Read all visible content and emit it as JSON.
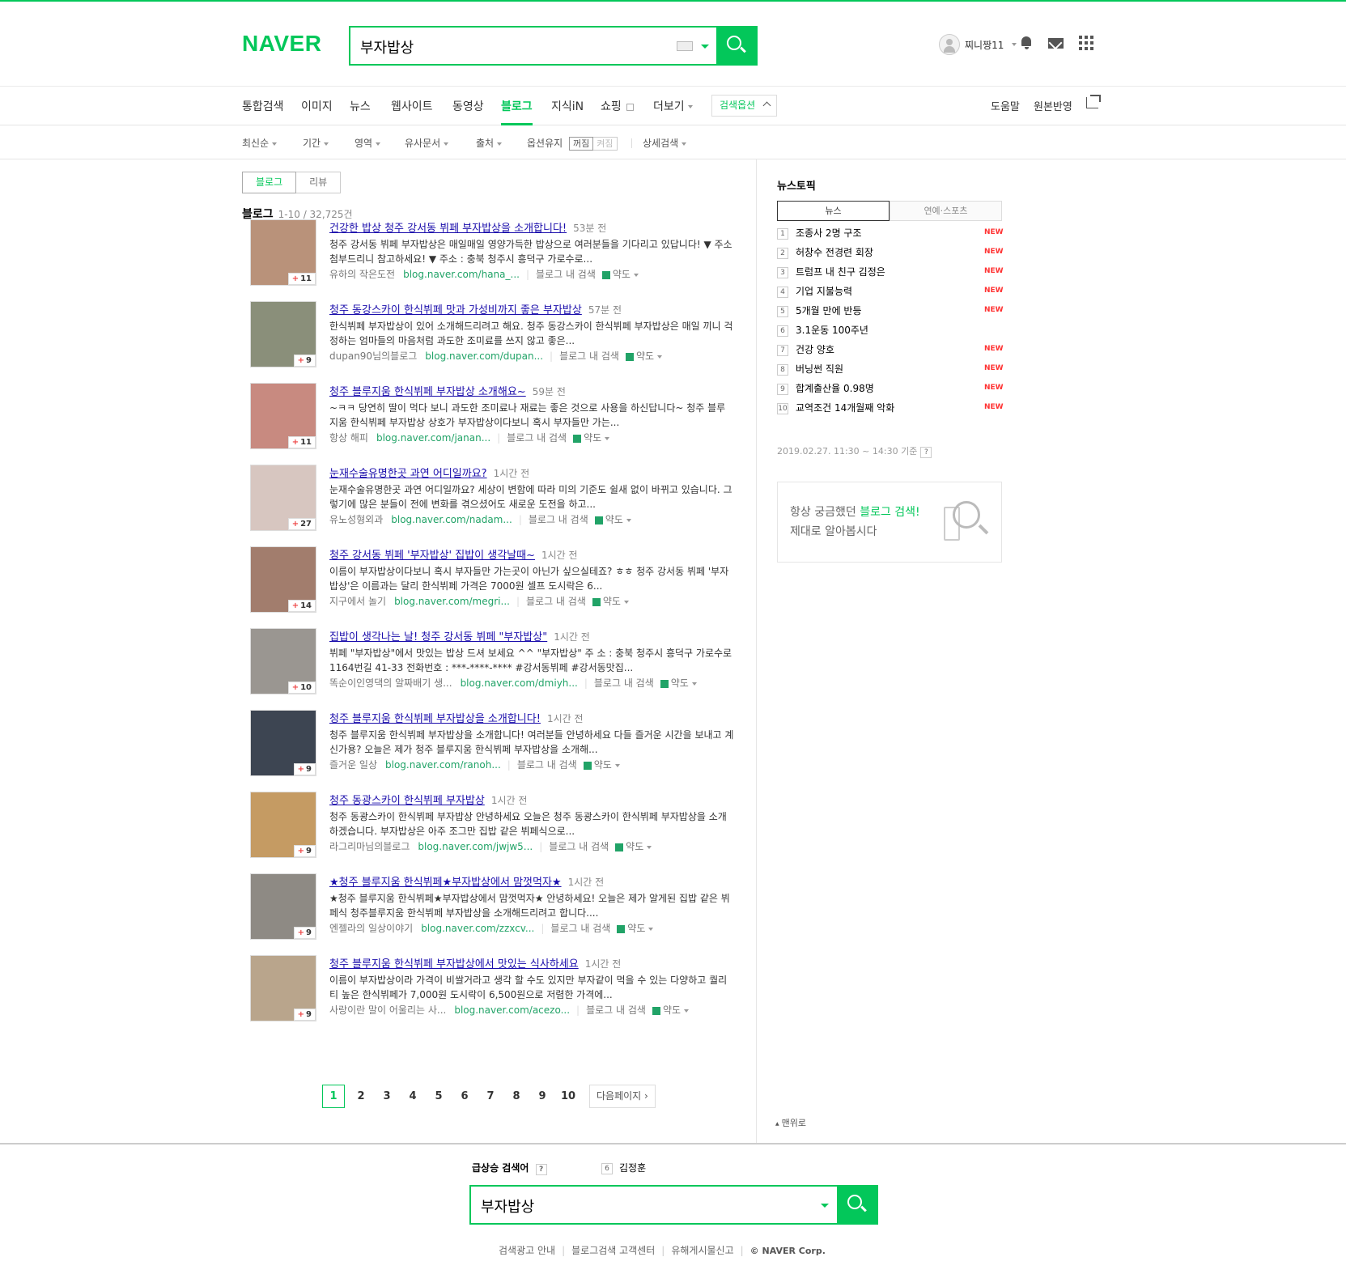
{
  "header": {
    "logo": "NAVER",
    "query": "부자밥상",
    "user_name": "찌니짱11"
  },
  "tabs": [
    "통합검색",
    "이미지",
    "뉴스",
    "웹사이트",
    "동영상",
    "블로그",
    "지식iN",
    "쇼핑",
    "더보기",
    "검색옵션"
  ],
  "right_tabs": [
    "도움말",
    "원본반영"
  ],
  "filters": {
    "sort": "최신순",
    "period": "기간",
    "area": "영역",
    "similar": "유사문서",
    "source": "출처",
    "keep_option": "옵션유지",
    "on": "꺼짐",
    "off": "켜짐",
    "detail": "상세검색"
  },
  "subtabs": [
    "블로그",
    "리뷰"
  ],
  "result_count": {
    "label": "블로그",
    "range": "1-10 / 32,725건"
  },
  "results": [
    {
      "title": "건강한 밥상 청주 강서동 뷔페 부자밥상을 소개합니다!",
      "time": "53분 전",
      "desc": "청주 강서동 뷔페 부자밥상은 매일매일 영양가득한 밥상으로 여러분들을 기다리고 있답니다! ▼ 주소 첨부드리니 참고하세요! ▼ 주소 : 충북 청주시 흥덕구 가로수로...",
      "author": "유하의 작은도전",
      "url": "blog.naver.com/hana_...",
      "inblog": "블로그 내 검색",
      "map": "약도",
      "count": "11"
    },
    {
      "title": "청주 동강스카이 한식뷔페 맛과 가성비까지 좋은 부자밥상",
      "time": "57분 전",
      "desc": "한식뷔페 부자밥상이 있어 소개해드리려고 해요. 청주 동강스카이 한식뷔페 부자밥상은 매일 끼니 걱정하는 엄마들의 마음처럼 과도한 조미료를 쓰지 않고 좋은...",
      "author": "dupan90님의블로그",
      "url": "blog.naver.com/dupan...",
      "inblog": "블로그 내 검색",
      "map": "약도",
      "count": "9"
    },
    {
      "title": "청주 블루지움 한식뷔페 부자밥상 소개해요~",
      "time": "59분 전",
      "desc": "~ㅋㅋ 당연히 딸이 먹다 보니 과도한 조미료나 재료는 좋은 것으로 사용을 하신답니다~ 청주 블루지움 한식뷔페 부자밥상 상호가 부자밥상이다보니 혹시 부자들만 가는...",
      "author": "항상 해피",
      "url": "blog.naver.com/janan...",
      "inblog": "블로그 내 검색",
      "map": "약도",
      "count": "11"
    },
    {
      "title": "눈재수술유명한곳 과연 어디일까요?",
      "time": "1시간 전",
      "desc": "눈재수술유명한곳 과연 어디일까요? 세상이 변함에 따라 미의 기준도 쉴새 없이 바뀌고 있습니다. 그렇기에 많은 분들이 전에 변화를 겪으셨어도 새로운 도전을 하고...",
      "author": "유노성형외과",
      "url": "blog.naver.com/nadam...",
      "inblog": "블로그 내 검색",
      "map": "약도",
      "count": "27"
    },
    {
      "title": "청주 강서동 뷔페 '부자밥상' 집밥이 생각날때~",
      "time": "1시간 전",
      "desc": "이름이 부자밥상이다보니 혹시 부자들만 가는곳이 아닌가 싶으실테죠? ㅎㅎ 청주 강서동 뷔페 '부자밥상'은 이름과는 달리 한식뷔페 가격은 7000원 셀프 도시락은 6...",
      "author": "지구에서 놀기",
      "url": "blog.naver.com/megri...",
      "inblog": "블로그 내 검색",
      "map": "약도",
      "count": "14"
    },
    {
      "title": "집밥이 생각나는 날! 청주 강서동 뷔페 \"부자밥상\"",
      "time": "1시간 전",
      "desc": "뷔페 \"부자밥상\"에서 맛있는 밥상 드셔 보세요 ^^ \"부자밥상\" 주 소 : 충북 청주시 흥덕구 가로수로1164번길 41-33 전화번호 : ***-****-**** #강서동뷔페 #강서동맛집...",
      "author": "똑순이인영댁의 알짜배기 생...",
      "url": "blog.naver.com/dmiyh...",
      "inblog": "블로그 내 검색",
      "map": "약도",
      "count": "10"
    },
    {
      "title": "청주 블루지움 한식뷔페 부자밥상을 소개합니다!",
      "time": "1시간 전",
      "desc": "청주 블루지움 한식뷔페 부자밥상을 소개합니다! 여러분들 안녕하세요 다들 즐거운 시간을 보내고 계신가용? 오늘은 제가 청주 블루지움 한식뷔페 부자밥상을 소개해...",
      "author": "즐거운 일상",
      "url": "blog.naver.com/ranoh...",
      "inblog": "블로그 내 검색",
      "map": "약도",
      "count": "9"
    },
    {
      "title": "청주 동광스카이 한식뷔페 부자밥상",
      "time": "1시간 전",
      "desc": "청주 동광스카이 한식뷔페 부자밥상 안녕하세요 오늘은 청주 동광스카이 한식뷔페 부자밥상을 소개하겠습니다. 부자밥상은 아주 조그만 집밥 같은 뷔페식으로...",
      "author": "라그리마님의블로그",
      "url": "blog.naver.com/jwjw5...",
      "inblog": "블로그 내 검색",
      "map": "약도",
      "count": "9"
    },
    {
      "title": "★청주 블루지움 한식뷔페★부자밥상에서 맘껏먹자★",
      "time": "1시간 전",
      "desc": "★청주 블루지움 한식뷔페★부자밥상에서 맘껏먹자★ 안녕하세요! 오늘은 제가 알게된 집밥 같은 뷔페식 청주블루지움 한식뷔페 부자밥상을 소개해드리려고 합니다....",
      "author": "엔젤라의 일상이야기",
      "url": "blog.naver.com/zzxcv...",
      "inblog": "블로그 내 검색",
      "map": "약도",
      "count": "9"
    },
    {
      "title": "청주 블루지움 한식뷔페 부자밥상에서 맛있는 식사하세요",
      "time": "1시간 전",
      "desc": "이름이 부자밥상이라 가격이 비쌀거라고 생각 할 수도 있지만 부자같이 먹을 수 있는 다양하고 퀄리티 높은 한식뷔페가 7,000원 도시락이 6,500원으로 저렴한 가격에...",
      "author": "사랑이란 말이 어울리는 사...",
      "url": "blog.naver.com/acezo...",
      "inblog": "블로그 내 검색",
      "map": "약도",
      "count": "9"
    }
  ],
  "pager": {
    "pages": [
      "1",
      "2",
      "3",
      "4",
      "5",
      "6",
      "7",
      "8",
      "9",
      "10"
    ],
    "next": "다음페이지"
  },
  "sidebar": {
    "title": "뉴스토픽",
    "tabs": [
      "뉴스",
      "연예·스포츠"
    ],
    "topics": [
      {
        "rank": "1",
        "text": "조종사 2명 구조",
        "new": "NEW"
      },
      {
        "rank": "2",
        "text": "허창수 전경련 회장",
        "new": "NEW"
      },
      {
        "rank": "3",
        "text": "트럼프 내 친구 김정은",
        "new": "NEW"
      },
      {
        "rank": "4",
        "text": "기업 지불능력",
        "new": "NEW"
      },
      {
        "rank": "5",
        "text": "5개월 만에 반등",
        "new": "NEW"
      },
      {
        "rank": "6",
        "text": "3.1운동 100주년",
        "new": ""
      },
      {
        "rank": "7",
        "text": "건강 양호",
        "new": "NEW"
      },
      {
        "rank": "8",
        "text": "버닝썬 직원",
        "new": "NEW"
      },
      {
        "rank": "9",
        "text": "합계출산율 0.98명",
        "new": "NEW"
      },
      {
        "rank": "10",
        "text": "교역조건 14개월째 악화",
        "new": "NEW"
      }
    ],
    "date": "2019.02.27. 11:30 ~ 14:30 기준",
    "q": "?",
    "promo_pre": "항상 궁금했던 ",
    "promo_hl": "블로그 검색!",
    "promo_l2": "제대로 알아봅시다",
    "totop": "맨위로"
  },
  "footer": {
    "trend_label": "급상승 검색어",
    "trend_q": "?",
    "trend_rank": "6",
    "trend_text": "김정훈",
    "query": "부자밥상",
    "links": [
      "검색광고 안내",
      "블로그검색 고객센터",
      "유해게시물신고"
    ],
    "corp": "© NAVER Corp."
  },
  "colors": {
    "brand": "#03c75a",
    "link": "#1a0dab",
    "url": "#21a367",
    "new": "#ff3333"
  },
  "icons": [
    "search-icon",
    "keyboard-icon",
    "bell-icon",
    "mail-icon",
    "apps-icon",
    "share-icon",
    "map-icon"
  ]
}
